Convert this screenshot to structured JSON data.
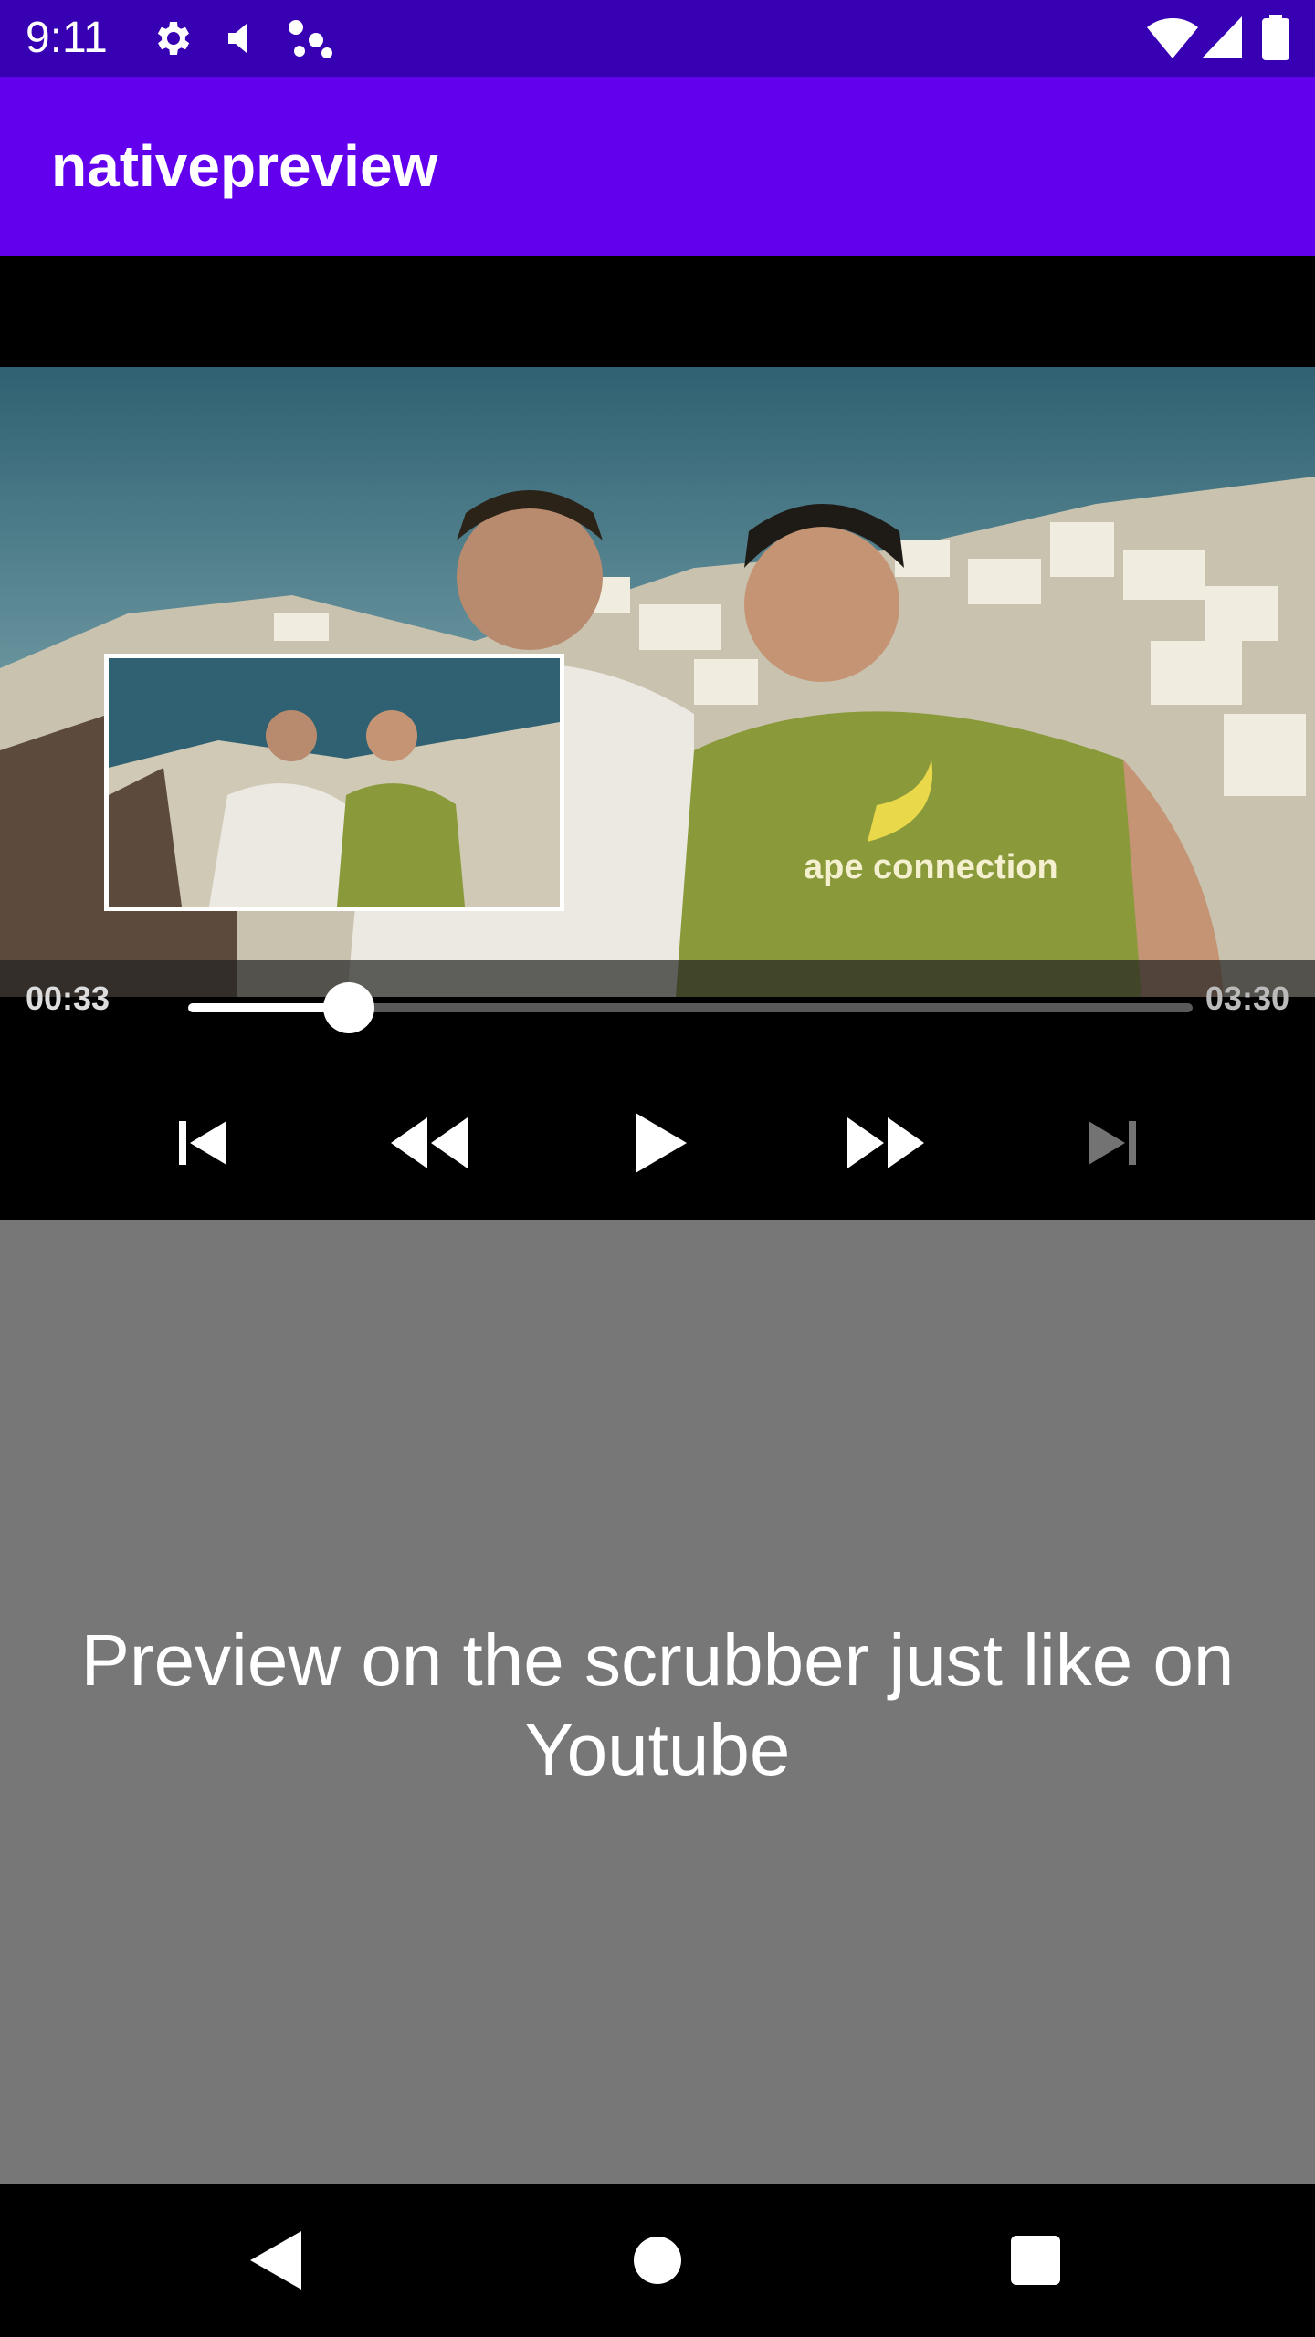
{
  "status_bar": {
    "time": "9:11",
    "icons": [
      "gear-icon",
      "volume-icon",
      "dots-icon",
      "wifi-icon",
      "signal-icon",
      "battery-icon"
    ]
  },
  "app_bar": {
    "title": "nativepreview",
    "color": "#6200ee"
  },
  "player": {
    "position_text": "00:33",
    "duration_text": "03:30",
    "progress": 0.16,
    "controls": [
      "previous-icon",
      "rewind-icon",
      "play-icon",
      "fast-forward-icon",
      "next-icon"
    ]
  },
  "content": {
    "caption": "Preview on the scrubber just like on Youtube",
    "background": "#777777"
  },
  "nav_bar": {
    "buttons": [
      "back-icon",
      "home-icon",
      "recents-icon"
    ]
  }
}
